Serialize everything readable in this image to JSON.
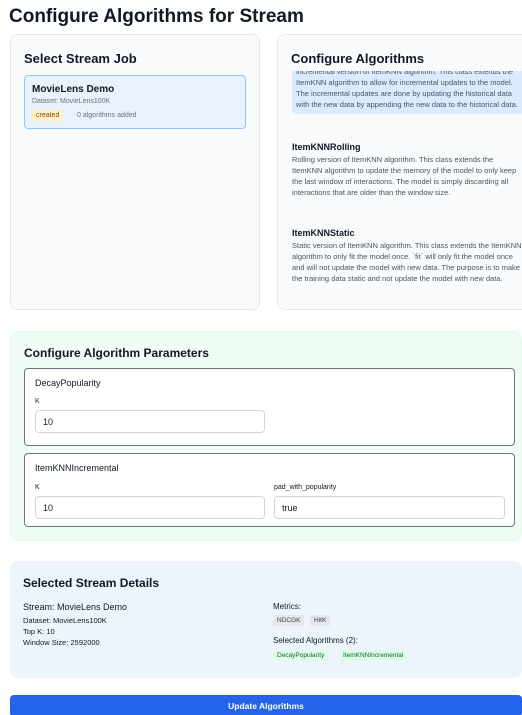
{
  "page": {
    "title": "Configure Algorithms for Stream"
  },
  "stream_job_panel": {
    "heading": "Select Stream Job",
    "job": {
      "name": "MovieLens Demo",
      "dataset": "Dataset: MovieLens100K",
      "status": "created",
      "algorithms_added": "0 algorithms added"
    }
  },
  "algorithms_panel": {
    "heading": "Configure Algorithms",
    "items": [
      {
        "name": "",
        "description": "incremental version of ItemKNN algorithm. This class extends the ItemKNN algorithm to allow for incremental updates to the model. The incremental updates are done by updating the historical data with the new data by appending the new data to the historical data."
      },
      {
        "name": "ItemKNNRolling",
        "description": "Rolling version of ItemKNN algorithm. This class extends the ItemKNN algorithm to update the memory of the model to only keep the last window of interactions. The model is simply discarding all interactions that are older than the window size."
      },
      {
        "name": "ItemKNNStatic",
        "description": "Static version of ItemKNN algorithm. This class extends the ItemKNN algorithm to only fit the model once. `fit` will only fit the model once and will not update the model with new data. The purpose is to make the training data static and not update the model with new data."
      }
    ]
  },
  "params_section": {
    "heading": "Configure Algorithm Parameters",
    "cards": [
      {
        "name": "DecayPopularity",
        "fields": [
          {
            "label": "K",
            "value": "10"
          }
        ]
      },
      {
        "name": "ItemKNNIncremental",
        "fields": [
          {
            "label": "K",
            "value": "10"
          },
          {
            "label": "pad_with_popularity",
            "value": "true"
          }
        ]
      }
    ]
  },
  "details_section": {
    "heading": "Selected Stream Details",
    "stream": "Stream: MovieLens Demo",
    "dataset": "Dataset: MovieLens100K",
    "top_k": "Top K: 10",
    "window_size": "Window Size: 2592000",
    "metrics_label": "Metrics:",
    "metrics": [
      "NDCGK",
      "HitK"
    ],
    "selected_algorithms_label": "Selected Algorithms (2):",
    "selected_algorithms": [
      "DecayPopularity",
      "ItemKNNIncremental"
    ]
  },
  "actions": {
    "update_label": "Update Algorithms"
  },
  "colors": {
    "primary": "#2563eb",
    "selected_card": "#dbeafe",
    "params_bg": "#f0fdf4",
    "details_bg": "#eef4fc",
    "badge_created": "#fef3c7",
    "algo_tag": "#dcfce7"
  }
}
